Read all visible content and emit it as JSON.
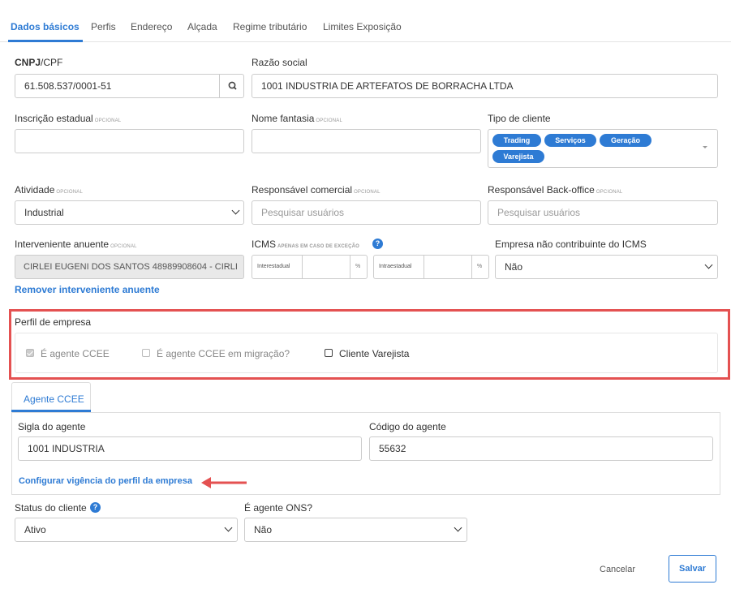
{
  "tabs": [
    "Dados básicos",
    "Perfis",
    "Endereço",
    "Alçada",
    "Regime tributário",
    "Limites Exposição"
  ],
  "fields": {
    "cnpj": {
      "label_bold": "CNPJ",
      "label_rest": "/CPF",
      "value": "61.508.537/0001-51"
    },
    "razao_social": {
      "label": "Razão social",
      "value": "1001 INDUSTRIA DE ARTEFATOS DE BORRACHA LTDA"
    },
    "inscricao": {
      "label": "Inscrição estadual",
      "optional": "OPCIONAL",
      "value": ""
    },
    "nome_fantasia": {
      "label": "Nome fantasia",
      "optional": "OPCIONAL",
      "value": ""
    },
    "tipo_cliente": {
      "label": "Tipo de cliente",
      "tags": [
        "Trading",
        "Serviços",
        "Geração",
        "Varejista"
      ]
    },
    "atividade": {
      "label": "Atividade",
      "optional": "OPCIONAL",
      "value": "Industrial"
    },
    "resp_comercial": {
      "label": "Responsável comercial",
      "optional": "OPCIONAL",
      "placeholder": "Pesquisar usuários"
    },
    "resp_backoffice": {
      "label": "Responsável Back-office",
      "optional": "OPCIONAL",
      "placeholder": "Pesquisar usuários"
    },
    "interveniente": {
      "label": "Interveniente anuente",
      "optional": "OPCIONAL",
      "value": "CIRLEI EUGENI DOS SANTOS 48989908604 - CIRLI"
    },
    "icms": {
      "label": "ICMS",
      "note": "APENAS EM CASO DE EXCEÇÃO",
      "interestadual": "Interestadual",
      "intraestadual": "Intraestadual",
      "unit": "%"
    },
    "nao_contribuinte": {
      "label": "Empresa não contribuinte do ICMS",
      "value": "Não"
    },
    "remover_link": "Remover interveniente anuente"
  },
  "perfil": {
    "title": "Perfil de empresa",
    "options": [
      "É agente CCEE",
      "É agente CCEE em migração?",
      "Cliente Varejista"
    ]
  },
  "agente_ccee": {
    "tab": "Agente CCEE",
    "sigla_label": "Sigla do agente",
    "sigla_value": "1001 INDUSTRIA",
    "codigo_label": "Código do agente",
    "codigo_value": "55632",
    "config_link": "Configurar vigência do perfil da empresa"
  },
  "status": {
    "label": "Status do cliente",
    "value": "Ativo"
  },
  "agente_ons": {
    "label": "É agente ONS?",
    "value": "Não"
  },
  "actions": {
    "cancel": "Cancelar",
    "save": "Salvar"
  },
  "colors": {
    "accent": "#2e7bd4",
    "highlight": "#e45151"
  }
}
